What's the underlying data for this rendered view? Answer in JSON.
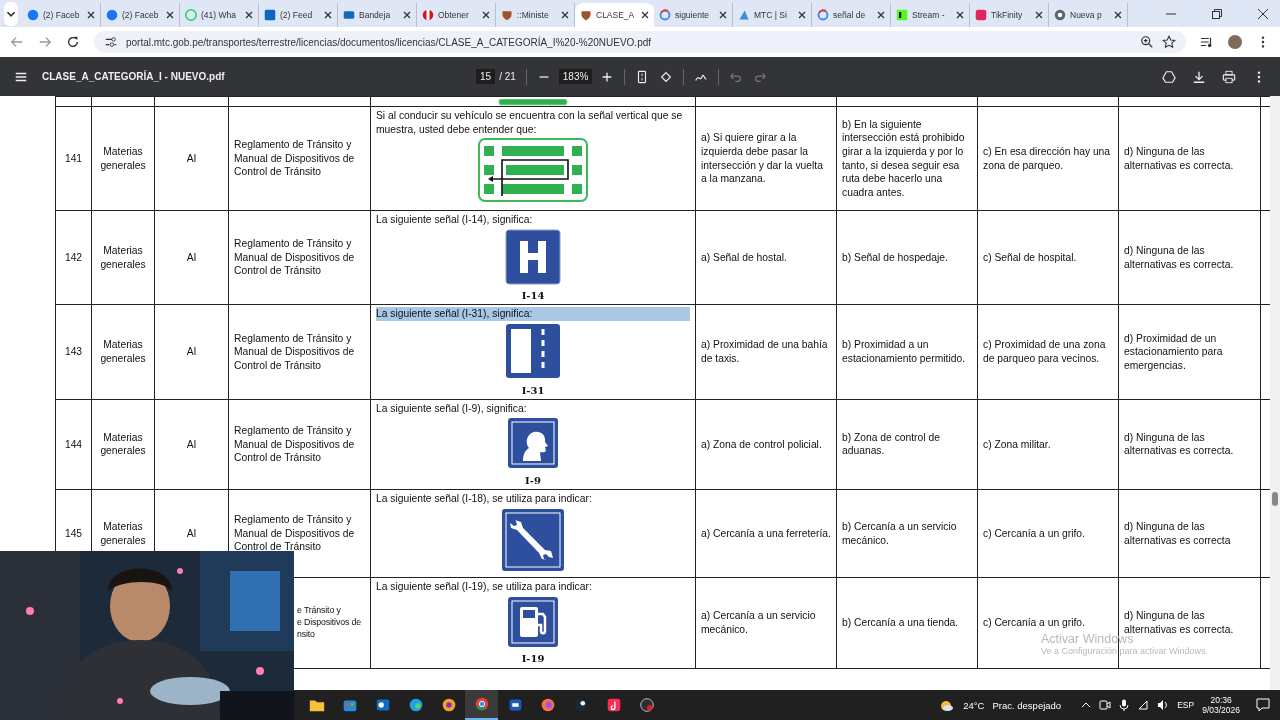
{
  "browser": {
    "tabs": [
      {
        "title": "(2) Faceb",
        "kind": "facebook",
        "selected": false
      },
      {
        "title": "(2) Faceb",
        "kind": "facebook",
        "selected": false
      },
      {
        "title": "(41) Wha",
        "kind": "whatsapp",
        "selected": false
      },
      {
        "title": "(2) Feed",
        "kind": "linkedin",
        "selected": false
      },
      {
        "title": "Bandeja",
        "kind": "mail",
        "selected": false
      },
      {
        "title": "Obtener",
        "kind": "flag",
        "selected": false
      },
      {
        "title": "::Ministe",
        "kind": "crest",
        "selected": false
      },
      {
        "title": "CLASE_A",
        "kind": "crest",
        "selected": true
      },
      {
        "title": "siguiente",
        "kind": "google",
        "selected": false
      },
      {
        "title": "MTC | Si",
        "kind": "sail",
        "selected": false
      },
      {
        "title": "señal de",
        "kind": "google",
        "selected": false
      },
      {
        "title": "Stream -",
        "kind": "kick",
        "selected": false
      },
      {
        "title": "TikFinity",
        "kind": "tikfinity",
        "selected": false
      },
      {
        "title": "Nueva p",
        "kind": "chrome",
        "selected": false
      }
    ],
    "address": "portal.mtc.gob.pe/transportes/terrestre/licencias/documentos/licencias/CLASE_A_CATEGORÍA_I%20-%20NUEVO.pdf"
  },
  "pdf_toolbar": {
    "title": "CLASE_A_CATEGORÍA_I - NUEVO.pdf",
    "page": "15",
    "page_total": "/ 21",
    "zoom": "183%"
  },
  "table": {
    "rows": [
      {
        "number": "141",
        "subject": "Materias generales",
        "category": "AI",
        "source": "Reglamento de Tránsito y Manual de Dispositivos de Control de Tránsito",
        "question": "Si al conducir su vehículo se encuentra con la señal vertical que se muestra, usted debe entender que:",
        "highlighted": false,
        "kind": "parking-lanes",
        "options": [
          "a) Si quiere girar a la izquierda debe pasar la intersección y dar la vuelta a la manzana.",
          "b) En la siguiente intersección está prohibido girar a la izquierda y por lo tanto, si desea seguir esa ruta debe hacerlo una cuadra antes.",
          "c) En esa dirección hay una zona de parqueo.",
          "d) Ninguna de las alternativas es correcta."
        ]
      },
      {
        "number": "142",
        "subject": "Materias generales",
        "category": "AI",
        "source": "Reglamento de Tránsito y Manual de Dispositivos de Control de Tránsito",
        "question": "La siguiente señal (I-14), significa:",
        "highlighted": false,
        "kind": "hospital",
        "sign_code": "I-14",
        "options": [
          "a) Señal de hostal.",
          "b) Señal de hospedaje.",
          "c) Señal de hospital.",
          "d) Ninguna de las alternativas es correcta."
        ]
      },
      {
        "number": "143",
        "subject": "Materias generales",
        "category": "AI",
        "source": "Reglamento de Tránsito y Manual de Dispositivos de Control de Tránsito",
        "question": "La siguiente señal (I-31), significa:",
        "highlighted": true,
        "kind": "parking-bay",
        "sign_code": "I-31",
        "options": [
          "a) Proximidad de una bahía de taxis.",
          "b) Proximidad a un estacionamiento permitido.",
          "c) Proximidad de una zona de parqueo para vecinos.",
          "d) Proximidad de un estacionamiento para emergencias."
        ]
      },
      {
        "number": "144",
        "subject": "Materias generales",
        "category": "AI",
        "source": "Reglamento de Tránsito y Manual de Dispositivos de Control de Tránsito",
        "question": "La siguiente señal (I-9), significa:",
        "highlighted": false,
        "kind": "customs",
        "sign_code": "I-9",
        "options": [
          "a) Zona de control policial.",
          "b) Zona de control de aduanas.",
          "c) Zona militar.",
          "d) Ninguna de las alternativas es correcta."
        ]
      },
      {
        "number": "145",
        "subject": "Materias generales",
        "category": "AI",
        "source": "Reglamento de Tránsito y Manual de Dispositivos de Control de Tránsito",
        "question": "La siguiente señal (I-18), se utiliza para indicar:",
        "highlighted": false,
        "kind": "wrench",
        "options": [
          "a) Cercanía a una ferretería.",
          "b) Cercanía a un servicio mecánico.",
          "c) Cercanía a un grifo.",
          "d) Ninguna de las alternativas es correcta"
        ]
      },
      {
        "source_cut": [
          "e Tránsito y",
          "e Dispositivos de",
          "nsito"
        ],
        "question": "La siguiente señal (I-19), se utiliza para indicar:",
        "highlighted": false,
        "kind": "fuel",
        "sign_code": "I-19",
        "options": [
          "a) Cercanía a un servicio mecánico.",
          "b) Cercanía a una tienda.",
          "c) Cercanía a un grifo.",
          "d) Ninguna de las alternativas es correcta."
        ]
      }
    ]
  },
  "activation_notice": {
    "title": "Activar Windows",
    "text": "Ve a Configuración para activar Windows."
  },
  "taskbar": {
    "apps": [
      {
        "kind": "folder",
        "selected": false
      },
      {
        "kind": "store",
        "selected": false
      },
      {
        "kind": "outlook",
        "selected": false
      },
      {
        "kind": "edge",
        "selected": false
      },
      {
        "kind": "lion",
        "selected": false
      },
      {
        "kind": "chrome",
        "selected": true
      },
      {
        "kind": "word",
        "selected": false
      },
      {
        "kind": "firefox",
        "selected": false
      },
      {
        "kind": "steam",
        "selected": false
      },
      {
        "kind": "tiktok",
        "selected": false
      },
      {
        "kind": "obs",
        "selected": false
      }
    ],
    "weather": {
      "temperature": "24°C",
      "condition": "Prac. despejado"
    },
    "language": "ESP",
    "time": "20:36",
    "date": "9/03/2026"
  }
}
